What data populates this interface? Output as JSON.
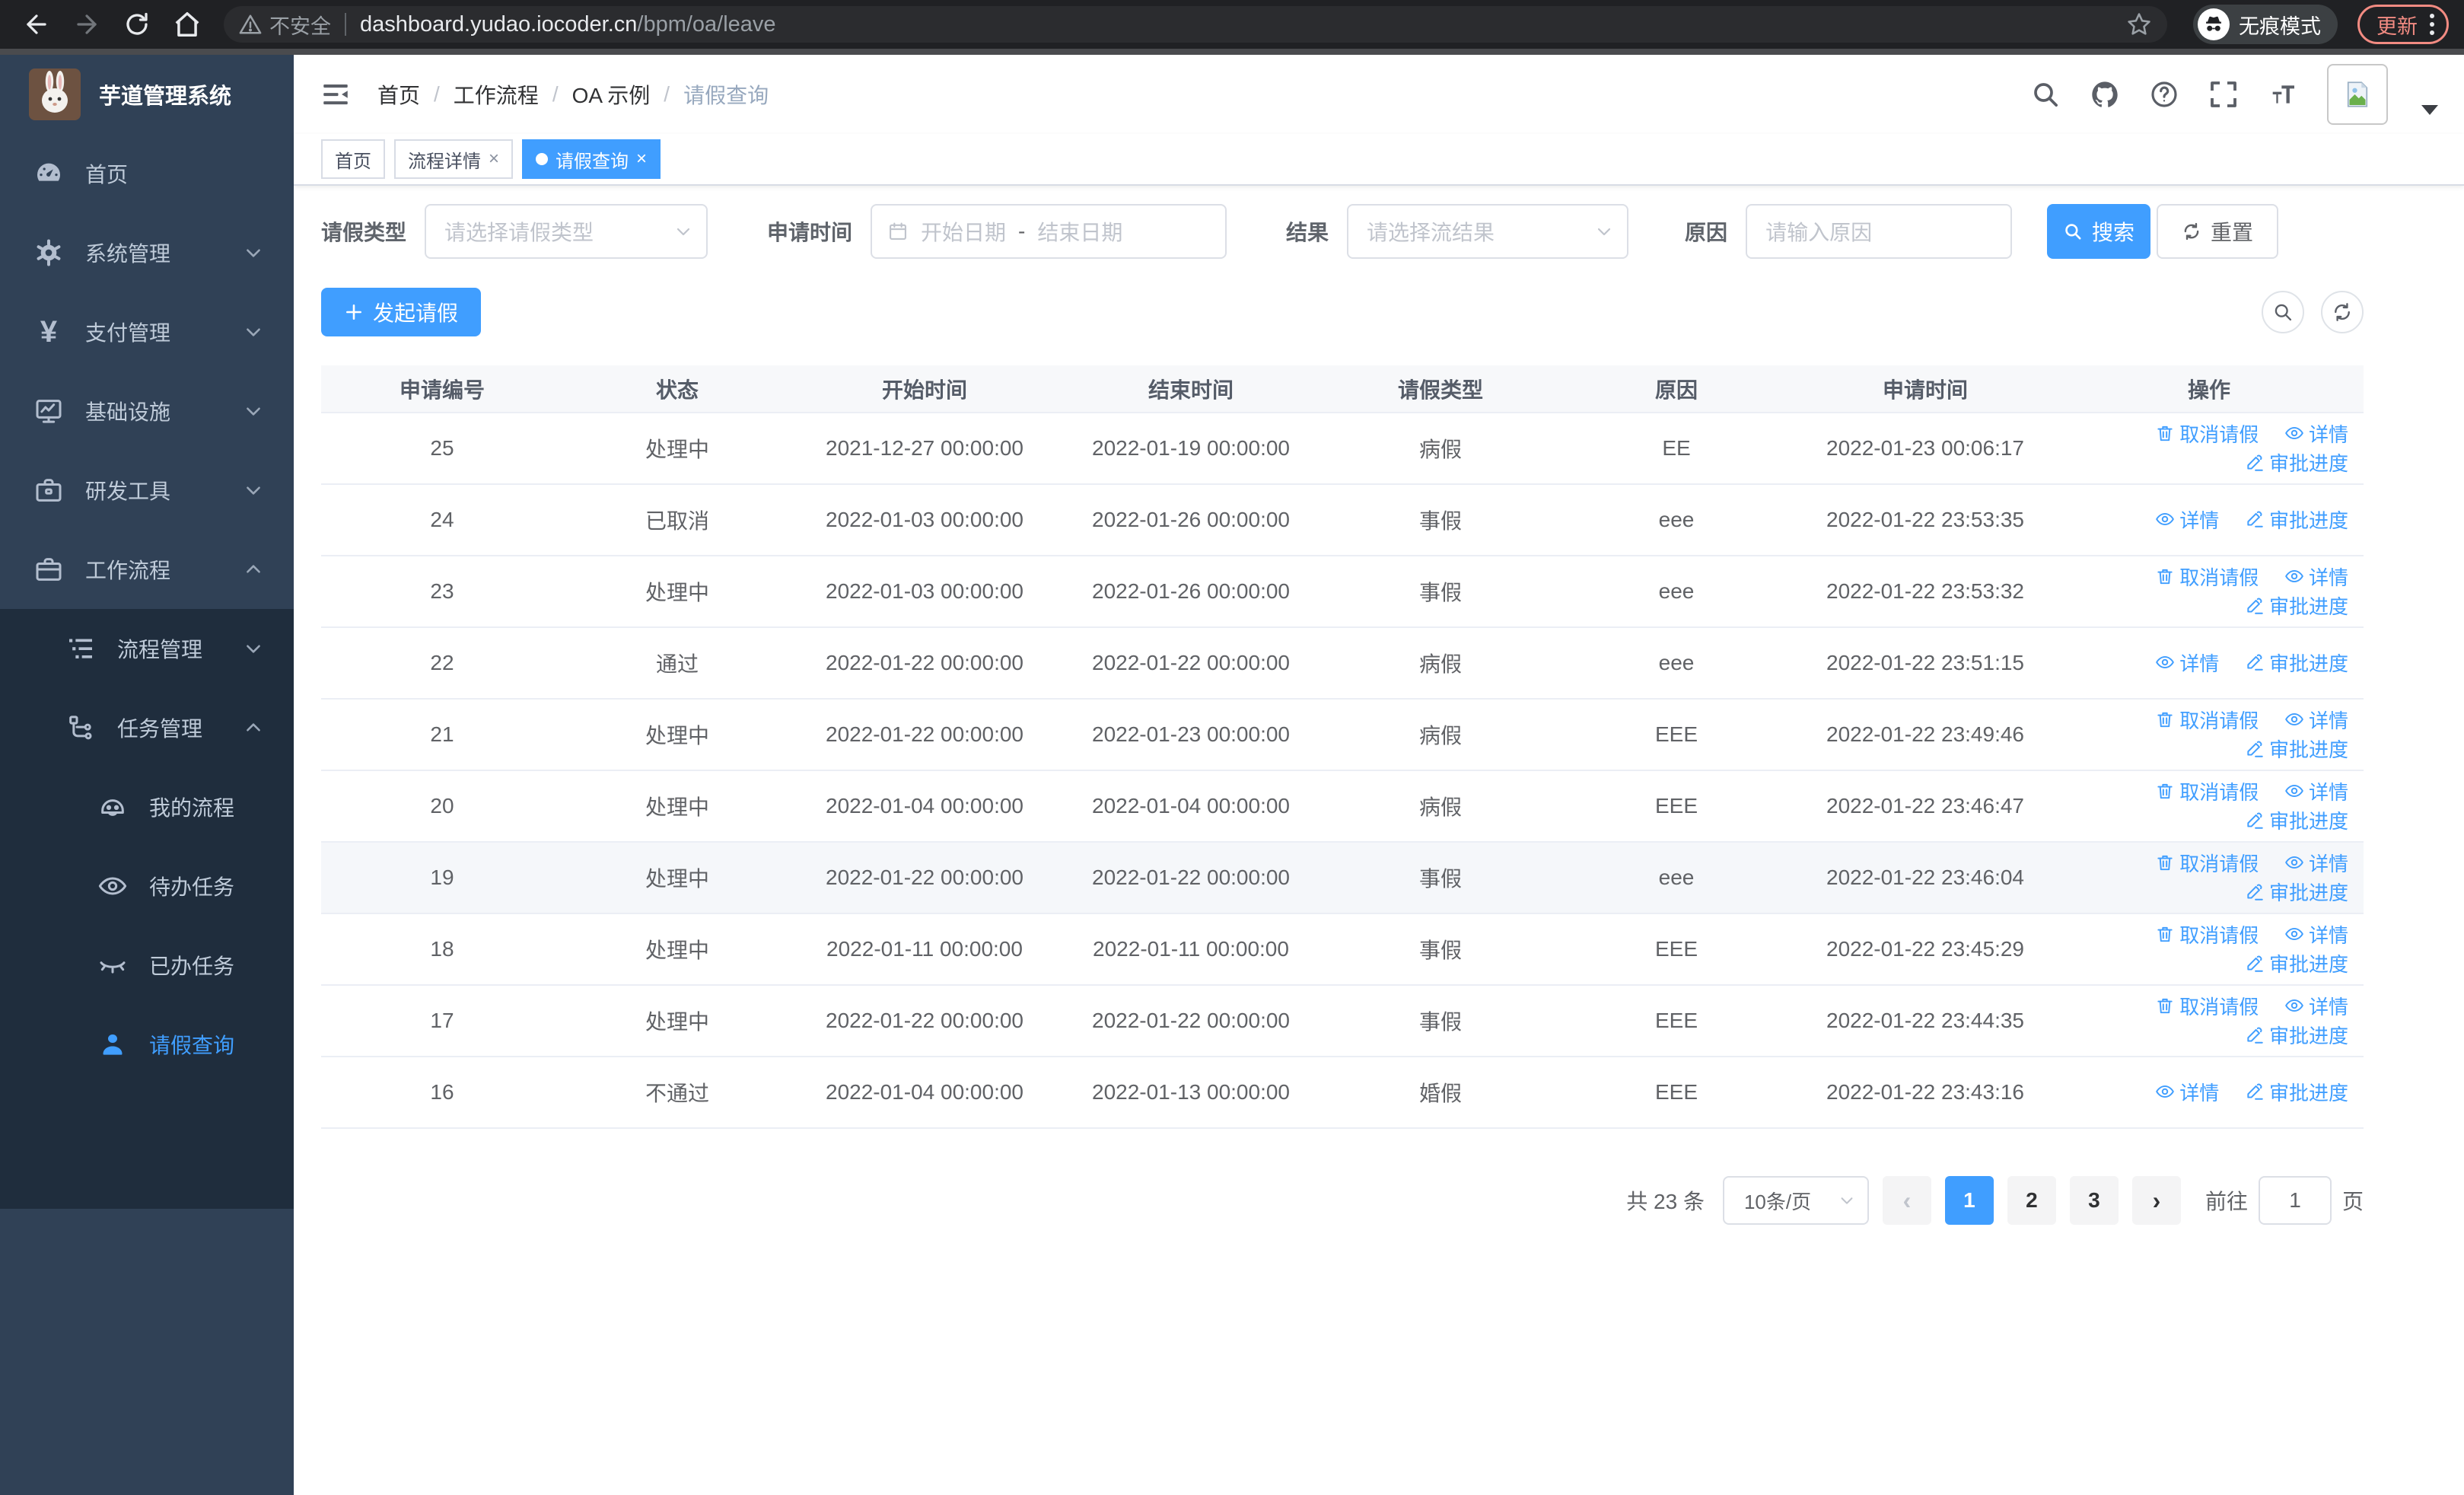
{
  "browser": {
    "security_warning": "不安全",
    "url_host": "dashboard.yudao.iocoder.cn",
    "url_path": "/bpm/oa/leave",
    "incognito_label": "无痕模式",
    "update_label": "更新"
  },
  "sidebar": {
    "app_title": "芋道管理系统",
    "items": [
      {
        "label": "首页",
        "icon": "dashboard-icon"
      },
      {
        "label": "系统管理",
        "icon": "gear-icon"
      },
      {
        "label": "支付管理",
        "icon": "yen-icon"
      },
      {
        "label": "基础设施",
        "icon": "monitor-icon"
      },
      {
        "label": "研发工具",
        "icon": "toolbox-icon"
      },
      {
        "label": "工作流程",
        "icon": "briefcase-icon",
        "expanded": true,
        "children": [
          {
            "label": "流程管理",
            "icon": "list-tree-icon"
          },
          {
            "label": "任务管理",
            "icon": "flow-icon",
            "expanded": true,
            "children": [
              {
                "label": "我的流程",
                "icon": "robot-face-icon"
              },
              {
                "label": "待办任务",
                "icon": "eye-open-icon"
              },
              {
                "label": "已办任务",
                "icon": "eye-closed-icon"
              },
              {
                "label": "请假查询",
                "icon": "user-icon",
                "active": true
              }
            ]
          }
        ]
      }
    ]
  },
  "header": {
    "breadcrumb": [
      "首页",
      "工作流程",
      "OA 示例",
      "请假查询"
    ]
  },
  "tabs": [
    {
      "label": "首页"
    },
    {
      "label": "流程详情",
      "closable": true
    },
    {
      "label": "请假查询",
      "closable": true,
      "active": true
    }
  ],
  "filters": {
    "leave_type_label": "请假类型",
    "leave_type_placeholder": "请选择请假类型",
    "apply_time_label": "申请时间",
    "date_start_placeholder": "开始日期",
    "date_separator": "-",
    "date_end_placeholder": "结束日期",
    "result_label": "结果",
    "result_placeholder": "请选择流结果",
    "reason_label": "原因",
    "reason_placeholder": "请输入原因",
    "search_button": "搜索",
    "reset_button": "重置"
  },
  "toolbar": {
    "create_button": "发起请假"
  },
  "table": {
    "columns": [
      "申请编号",
      "状态",
      "开始时间",
      "结束时间",
      "请假类型",
      "原因",
      "申请时间",
      "操作"
    ],
    "action_labels": {
      "cancel": "取消请假",
      "detail": "详情",
      "progress": "审批进度"
    },
    "rows": [
      {
        "id": "25",
        "status": "处理中",
        "start": "2021-12-27 00:00:00",
        "end": "2022-01-19 00:00:00",
        "type": "病假",
        "reason": "EE",
        "apply_time": "2022-01-23 00:06:17",
        "actions": [
          "cancel",
          "detail",
          "progress"
        ],
        "highlight": false
      },
      {
        "id": "24",
        "status": "已取消",
        "start": "2022-01-03 00:00:00",
        "end": "2022-01-26 00:00:00",
        "type": "事假",
        "reason": "eee",
        "apply_time": "2022-01-22 23:53:35",
        "actions": [
          "detail",
          "progress"
        ],
        "highlight": false
      },
      {
        "id": "23",
        "status": "处理中",
        "start": "2022-01-03 00:00:00",
        "end": "2022-01-26 00:00:00",
        "type": "事假",
        "reason": "eee",
        "apply_time": "2022-01-22 23:53:32",
        "actions": [
          "cancel",
          "detail",
          "progress"
        ],
        "highlight": false
      },
      {
        "id": "22",
        "status": "通过",
        "start": "2022-01-22 00:00:00",
        "end": "2022-01-22 00:00:00",
        "type": "病假",
        "reason": "eee",
        "apply_time": "2022-01-22 23:51:15",
        "actions": [
          "detail",
          "progress"
        ],
        "highlight": false
      },
      {
        "id": "21",
        "status": "处理中",
        "start": "2022-01-22 00:00:00",
        "end": "2022-01-23 00:00:00",
        "type": "病假",
        "reason": "EEE",
        "apply_time": "2022-01-22 23:49:46",
        "actions": [
          "cancel",
          "detail",
          "progress"
        ],
        "highlight": false
      },
      {
        "id": "20",
        "status": "处理中",
        "start": "2022-01-04 00:00:00",
        "end": "2022-01-04 00:00:00",
        "type": "病假",
        "reason": "EEE",
        "apply_time": "2022-01-22 23:46:47",
        "actions": [
          "cancel",
          "detail",
          "progress"
        ],
        "highlight": false
      },
      {
        "id": "19",
        "status": "处理中",
        "start": "2022-01-22 00:00:00",
        "end": "2022-01-22 00:00:00",
        "type": "事假",
        "reason": "eee",
        "apply_time": "2022-01-22 23:46:04",
        "actions": [
          "cancel",
          "detail",
          "progress"
        ],
        "highlight": true
      },
      {
        "id": "18",
        "status": "处理中",
        "start": "2022-01-11 00:00:00",
        "end": "2022-01-11 00:00:00",
        "type": "事假",
        "reason": "EEE",
        "apply_time": "2022-01-22 23:45:29",
        "actions": [
          "cancel",
          "detail",
          "progress"
        ],
        "highlight": false
      },
      {
        "id": "17",
        "status": "处理中",
        "start": "2022-01-22 00:00:00",
        "end": "2022-01-22 00:00:00",
        "type": "事假",
        "reason": "EEE",
        "apply_time": "2022-01-22 23:44:35",
        "actions": [
          "cancel",
          "detail",
          "progress"
        ],
        "highlight": false
      },
      {
        "id": "16",
        "status": "不通过",
        "start": "2022-01-04 00:00:00",
        "end": "2022-01-13 00:00:00",
        "type": "婚假",
        "reason": "EEE",
        "apply_time": "2022-01-22 23:43:16",
        "actions": [
          "detail",
          "progress"
        ],
        "highlight": false
      }
    ]
  },
  "pagination": {
    "total_text": "共 23 条",
    "page_size": "10条/页",
    "pages": [
      "1",
      "2",
      "3"
    ],
    "active_page": "1",
    "goto_label": "前往",
    "goto_value": "1",
    "goto_suffix": "页"
  },
  "colors": {
    "primary": "#409eff",
    "sidebar_bg": "#304156",
    "submenu_bg": "#1f2d3d",
    "sidebar_text": "#bfcbd9",
    "update_chip": "#f28b82",
    "table_border": "#ebeef5",
    "header_bg": "#f7f8fa"
  }
}
